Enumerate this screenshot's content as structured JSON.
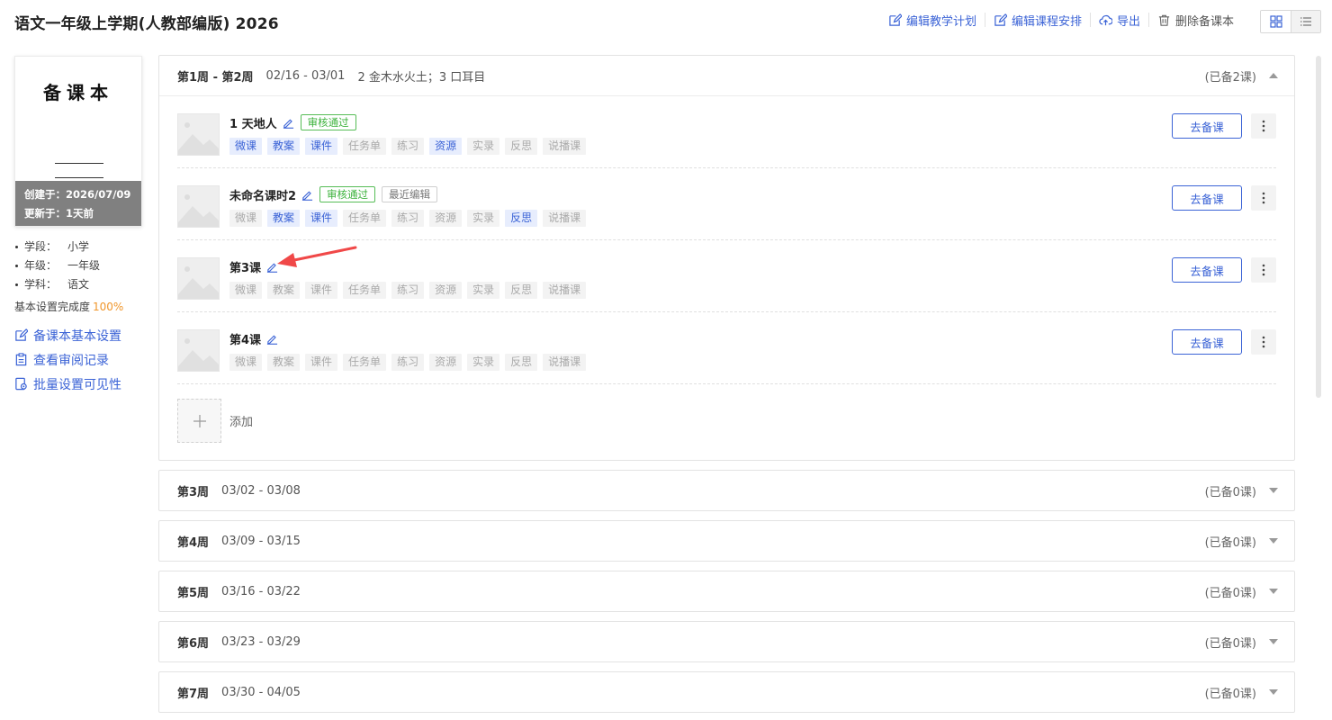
{
  "header": {
    "title": "语文一年级上学期(人教部编版) 2026",
    "actions": {
      "edit_plan": "编辑教学计划",
      "edit_schedule": "编辑课程安排",
      "export": "导出",
      "delete": "删除备课本"
    }
  },
  "sidebar": {
    "cover_title": "备课本",
    "created": "创建于：2026/07/09",
    "updated": "更新于：1天前",
    "info": [
      {
        "key": "学段：",
        "value": "小学"
      },
      {
        "key": "年级：",
        "value": "一年级"
      },
      {
        "key": "学科：",
        "value": "语文"
      }
    ],
    "progress_label": "基本设置完成度",
    "progress_value": "100%",
    "links": {
      "basic_settings": "备课本基本设置",
      "review_log": "查看审阅记录",
      "batch_visibility": "批量设置可见性"
    }
  },
  "weeks": {
    "w1": {
      "name": "第1周 - 第2周",
      "date": "02/16 - 03/01",
      "units": "2 金木水火土；3 口耳目",
      "count": "(已备2课)",
      "expanded": true
    },
    "w3": {
      "name": "第3周",
      "date": "03/02 - 03/08",
      "count": "(已备0课)"
    },
    "w4": {
      "name": "第4周",
      "date": "03/09 - 03/15",
      "count": "(已备0课)"
    },
    "w5": {
      "name": "第5周",
      "date": "03/16 - 03/22",
      "count": "(已备0课)"
    },
    "w6": {
      "name": "第6周",
      "date": "03/23 - 03/29",
      "count": "(已备0课)"
    },
    "w7": {
      "name": "第7周",
      "date": "03/30 - 04/05",
      "count": "(已备0课)"
    }
  },
  "tag_labels": [
    "微课",
    "教案",
    "课件",
    "任务单",
    "练习",
    "资源",
    "实录",
    "反思",
    "说播课"
  ],
  "lessons": [
    {
      "title": "1 天地人",
      "badges": [
        {
          "text": "审核通过",
          "style": "green"
        }
      ],
      "active_tags": [
        "微课",
        "教案",
        "课件",
        "资源"
      ]
    },
    {
      "title": "未命名课时2",
      "badges": [
        {
          "text": "审核通过",
          "style": "green"
        },
        {
          "text": "最近编辑",
          "style": "gray"
        }
      ],
      "active_tags": [
        "教案",
        "课件",
        "反思"
      ]
    },
    {
      "title": "第3课",
      "badges": [],
      "active_tags": []
    },
    {
      "title": "第4课",
      "badges": [],
      "active_tags": []
    }
  ],
  "lesson_button": "去备课",
  "add_label": "添加",
  "colors": {
    "accent": "#3b63d6",
    "approved": "#3bb23b",
    "progress": "#f0962b",
    "annotation_arrow": "#f04848"
  }
}
